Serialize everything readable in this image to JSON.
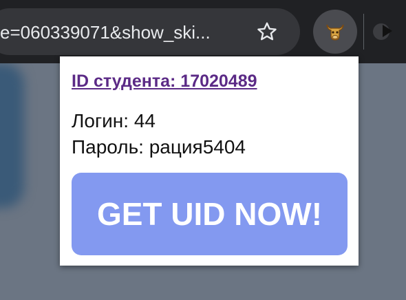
{
  "browser": {
    "url_fragment": "e=060339071&show_ski...",
    "star_icon": "star-outline-icon",
    "extension_icon": "bull-head-icon",
    "secondary_extension_icon": "play-icon"
  },
  "popup": {
    "student_id_link": "ID студента: 17020489",
    "login_text": "Логин: 44",
    "password_text": "Пароль: рация5404",
    "button_label": "GET UID NOW!",
    "colors": {
      "link": "#5b2a86",
      "button": "#8399f0",
      "button_text": "#ffffff"
    }
  }
}
